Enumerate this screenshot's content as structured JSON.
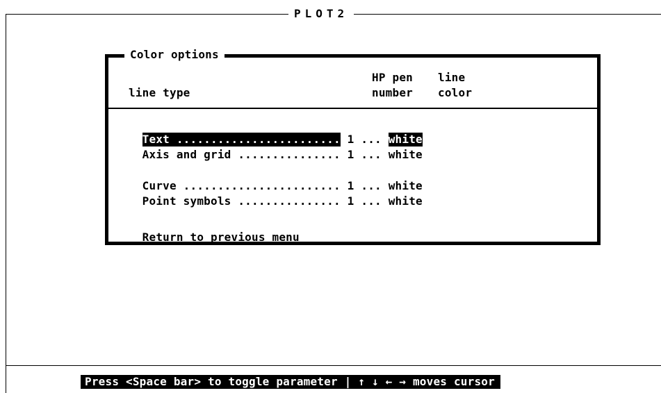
{
  "app": {
    "title": "PLOT2"
  },
  "dialog": {
    "title": "Color options",
    "headers": {
      "line_type": "line type",
      "pen_top": "HP pen",
      "pen_bottom": "number",
      "color_top": "line",
      "color_bottom": "color"
    },
    "rows": [
      {
        "label": "Text ........................",
        "pen": "1",
        "sep": "...",
        "color": "white",
        "selected": true
      },
      {
        "label": "Axis and grid ...............",
        "pen": "1",
        "sep": "...",
        "color": "white",
        "selected": false
      },
      {
        "label": "Curve .......................",
        "pen": "1",
        "sep": "...",
        "color": "white",
        "selected": false
      },
      {
        "label": "Point symbols ...............",
        "pen": "1",
        "sep": "...",
        "color": "white",
        "selected": false
      }
    ],
    "return_label": "Return to previous menu"
  },
  "status_bar": {
    "text": "Press <Space bar> to toggle parameter | ↑ ↓ ← → moves cursor"
  }
}
